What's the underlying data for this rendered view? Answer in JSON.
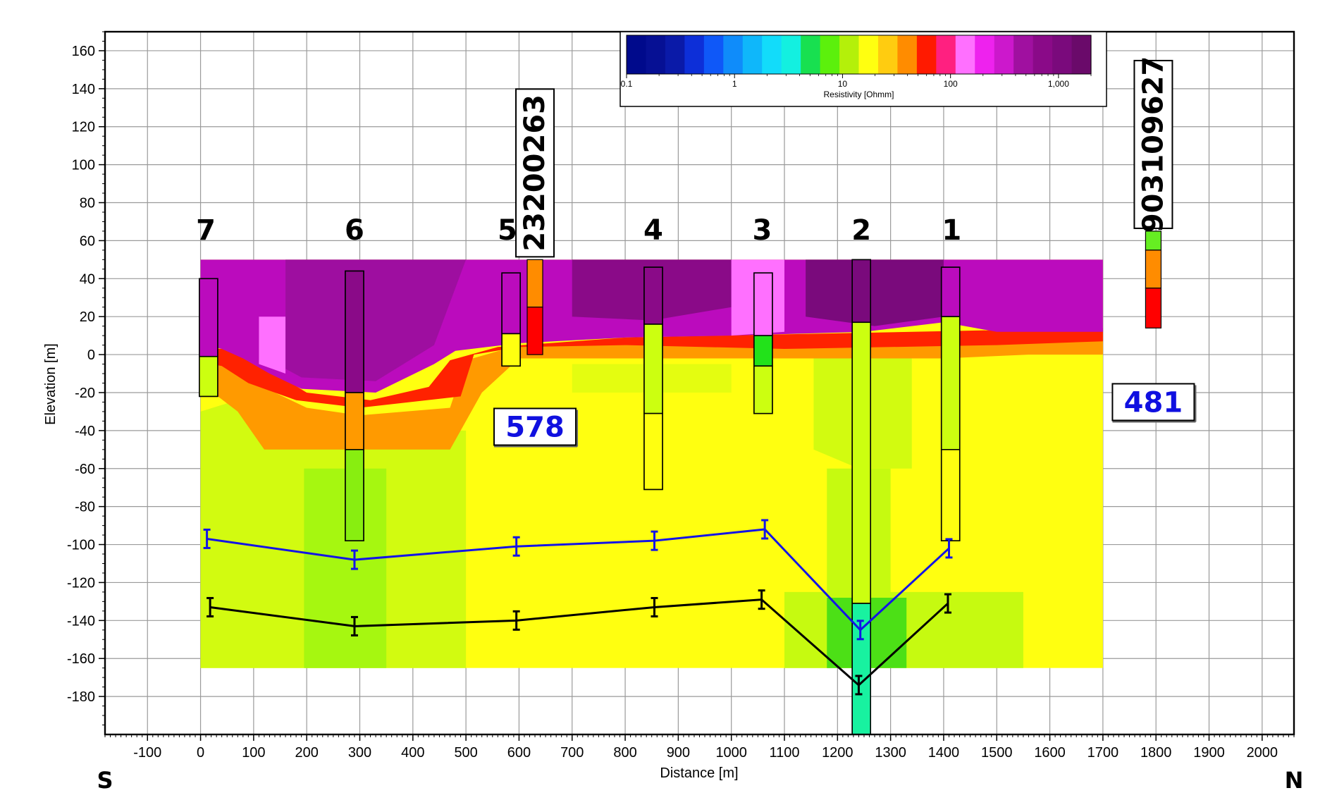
{
  "chart_data": {
    "type": "heatmap",
    "xlabel": "Distance [m]",
    "ylabel": "Elevation [m]",
    "xlim": [
      -180,
      2060
    ],
    "ylim": [
      -200,
      170
    ],
    "x_ticks": [
      -100,
      0,
      100,
      200,
      300,
      400,
      500,
      600,
      700,
      800,
      900,
      1000,
      1100,
      1200,
      1300,
      1400,
      1500,
      1600,
      1700,
      1800,
      1900,
      2000
    ],
    "y_ticks": [
      160,
      140,
      120,
      100,
      80,
      60,
      40,
      20,
      0,
      -20,
      -40,
      -60,
      -80,
      -100,
      -120,
      -140,
      -160,
      -180
    ],
    "direction_left": "S",
    "direction_right": "N",
    "grid": true,
    "colorbar": {
      "title": "Resistivity [Ohmm]",
      "scale": "log",
      "range": [
        0.1,
        2000
      ],
      "tick_labels": [
        "0.1",
        "1",
        "10",
        "100",
        "1,000"
      ],
      "colors": [
        "#000a8c",
        "#061094",
        "#0a1aa8",
        "#0d2fd8",
        "#0f58f8",
        "#0f8cfa",
        "#0fb7fa",
        "#12dcfa",
        "#13f0e0",
        "#18e050",
        "#5cf00c",
        "#b4f00a",
        "#ffff10",
        "#ffcc10",
        "#ff8c00",
        "#ff1a00",
        "#ff2080",
        "#ff70ff",
        "#ee22ee",
        "#cc18cc",
        "#a010a0",
        "#8a0a88",
        "#7a0a7c",
        "#6a0a6a"
      ]
    },
    "section": {
      "x_range": [
        0,
        1700
      ],
      "y_range": [
        -165,
        50
      ],
      "top_layer": {
        "color": "#bb0bbd",
        "bottom_elevation": 10
      },
      "background": {
        "color": "#ffff10"
      }
    },
    "stations": [
      {
        "label": "7",
        "x": 10
      },
      {
        "label": "6",
        "x": 290
      },
      {
        "label": "5",
        "x": 578
      },
      {
        "label": "4",
        "x": 853
      },
      {
        "label": "3",
        "x": 1058
      },
      {
        "label": "2",
        "x": 1245
      },
      {
        "label": "1",
        "x": 1415
      }
    ],
    "series": [
      {
        "name": "",
        "color": "#1414e6",
        "x": [
          12,
          290,
          595,
          855,
          1063,
          1243,
          1410
        ],
        "y": [
          -97,
          -108,
          -101,
          -98,
          -92,
          -145,
          -102
        ]
      },
      {
        "name": "",
        "color": "#000000",
        "x": [
          18,
          290,
          595,
          855,
          1057,
          1240,
          1408
        ],
        "y": [
          -133,
          -143,
          -140,
          -133,
          -129,
          -174,
          -131
        ]
      }
    ],
    "boreholes": [
      {
        "x": 15,
        "top": 40,
        "bottom": -22,
        "intervals": [
          {
            "top": 40,
            "bottom": -1,
            "color": "#bb0bbd"
          },
          {
            "top": -1,
            "bottom": -22,
            "color": "#ccff10"
          }
        ]
      },
      {
        "x": 290,
        "top": 44,
        "bottom": -98,
        "intervals": [
          {
            "top": 44,
            "bottom": -20,
            "color": "#8a0a88"
          },
          {
            "top": -20,
            "bottom": -50,
            "color": "#ff9a00"
          },
          {
            "top": -50,
            "bottom": -98,
            "color": "#88ee10"
          }
        ]
      },
      {
        "x": 585,
        "top": 43,
        "bottom": -6,
        "intervals": [
          {
            "top": 43,
            "bottom": 11,
            "color": "#bb0bbd"
          },
          {
            "top": 11,
            "bottom": -6,
            "color": "#ffff10"
          }
        ]
      },
      {
        "x": 853,
        "top": 46,
        "bottom": -71,
        "intervals": [
          {
            "top": 46,
            "bottom": 16,
            "color": "#8a0a88"
          },
          {
            "top": 16,
            "bottom": -31,
            "color": "#ccff10"
          },
          {
            "top": -31,
            "bottom": -71,
            "color": "#ffff10"
          }
        ]
      },
      {
        "x": 1060,
        "top": 43,
        "bottom": -31,
        "intervals": [
          {
            "top": 43,
            "bottom": 10,
            "color": "#ff70ff"
          },
          {
            "top": 10,
            "bottom": -6,
            "color": "#22e21a"
          },
          {
            "top": -6,
            "bottom": -31,
            "color": "#ccff10"
          }
        ]
      },
      {
        "x": 1245,
        "top": 50,
        "bottom": -200,
        "intervals": [
          {
            "top": 50,
            "bottom": 17,
            "color": "#7a0a7c"
          },
          {
            "top": 17,
            "bottom": -131,
            "color": "#ccff10"
          },
          {
            "top": -131,
            "bottom": -200,
            "color": "#18f2a0"
          }
        ]
      },
      {
        "x": 1413,
        "top": 46,
        "bottom": -98,
        "intervals": [
          {
            "top": 46,
            "bottom": 20,
            "color": "#bb0bbd"
          },
          {
            "top": 20,
            "bottom": -50,
            "color": "#ccff10"
          },
          {
            "top": -50,
            "bottom": -98,
            "color": "#ffff10"
          }
        ]
      }
    ],
    "wells": [
      {
        "id": "23200263",
        "x": 630,
        "intervals": [
          {
            "top": 50,
            "bottom": 25,
            "color": "#ff8c00"
          },
          {
            "top": 25,
            "bottom": 0,
            "color": "#ff0000"
          }
        ]
      },
      {
        "id": "903109627",
        "x": 1795,
        "intervals": [
          {
            "top": 65,
            "bottom": 55,
            "color": "#66ee22"
          },
          {
            "top": 55,
            "bottom": 35,
            "color": "#ff8c00"
          },
          {
            "top": 35,
            "bottom": 14,
            "color": "#ff0000"
          }
        ]
      }
    ],
    "markers": [
      {
        "text": "578",
        "x": 630,
        "y": -38
      },
      {
        "text": "481",
        "x": 1795,
        "y": -25
      }
    ]
  }
}
